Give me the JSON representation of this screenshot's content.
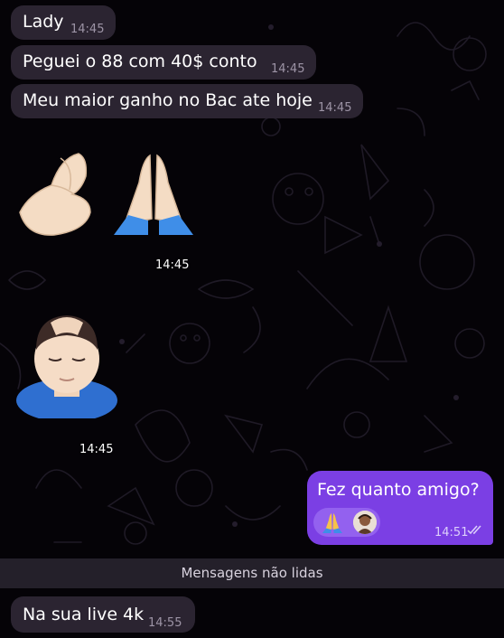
{
  "messages": [
    {
      "text": "Lady",
      "time": "14:45"
    },
    {
      "text": "Peguei o 88 com 40$ conto",
      "time": "14:45"
    },
    {
      "text": "Meu maior ganho no Bac ate hoje",
      "time": "14:45"
    }
  ],
  "sticker_group_1": {
    "emojis": [
      "pinched-fingers",
      "folded-hands"
    ],
    "time": "14:45"
  },
  "sticker_group_2": {
    "emojis": [
      "man-getting-massage"
    ],
    "time": "14:45"
  },
  "outgoing": {
    "text": "Fez quanto amigo?",
    "time": "14:51",
    "status": "read",
    "reactions": [
      "folded-hands",
      "user-avatar"
    ]
  },
  "unread_divider": "Mensagens não lidas",
  "last_message": {
    "text": "Na sua live 4k",
    "time": "14:55"
  },
  "colors": {
    "background": "#050307",
    "incoming_bubble": "#2b2431",
    "outgoing_bubble": "#7b3fe4",
    "reaction_pill": "#9361ef",
    "divider": "#24202a"
  }
}
